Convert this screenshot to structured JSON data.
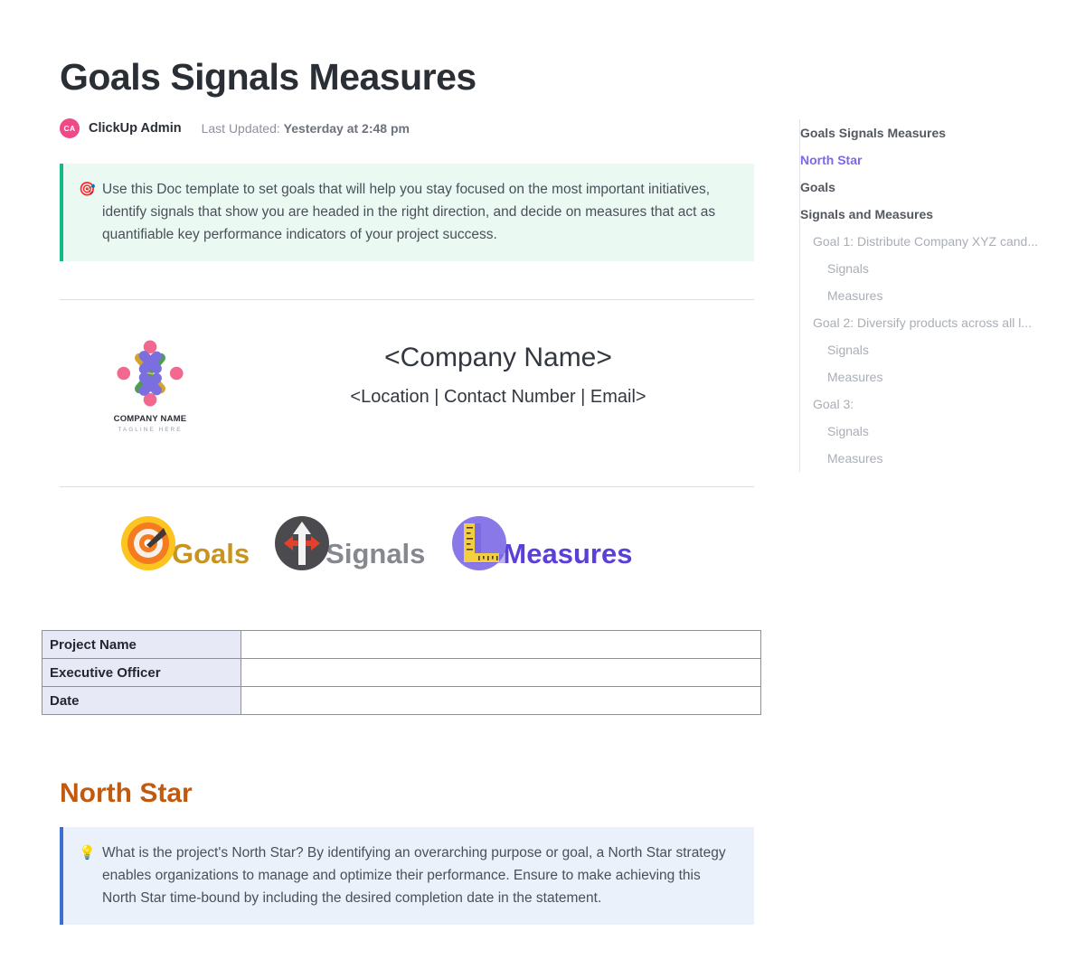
{
  "document": {
    "title": "Goals Signals Measures",
    "byline": {
      "avatar_initials": "CA",
      "author": "ClickUp Admin",
      "updated_prefix": "Last Updated:",
      "updated_value": "Yesterday at 2:48 pm"
    },
    "intro_callout": {
      "icon": "dart-target-emoji",
      "glyph": "🎯",
      "text": "Use this Doc template to set goals that will help you stay focused on the most important initiatives, identify signals that show you are headed in the right direction, and decide on measures that act as quantifiable key performance indicators of your project success.",
      "bar_color": "#14b98a",
      "background": "#eafaf3"
    },
    "company": {
      "logo_name": "COMPANY NAME",
      "logo_tagline": "TAGLINE HERE",
      "name": "<Company Name>",
      "contact": "<Location | Contact Number | Email>"
    },
    "gsm": [
      {
        "label": "Goals",
        "icon": "target-icon",
        "color": "#c8941e"
      },
      {
        "label": "Signals",
        "icon": "signpost-icon",
        "color": "#85898f"
      },
      {
        "label": "Measures",
        "icon": "ruler-icon",
        "color": "#5b3fd9"
      }
    ],
    "info_table": {
      "rows": [
        {
          "label": "Project Name",
          "value": ""
        },
        {
          "label": "Executive Officer",
          "value": ""
        },
        {
          "label": "Date",
          "value": ""
        }
      ]
    },
    "north_star": {
      "heading": "North Star",
      "heading_color": "#c1590f",
      "callout": {
        "icon": "lightbulb-emoji",
        "glyph": "💡",
        "text": "What is the project's North Star? By identifying an overarching purpose or goal, a North Star strategy enables organizations to manage and optimize their performance. Ensure to make achieving this North Star time-bound by including the desired completion date in the statement.",
        "bar_color": "#3b6fd4",
        "background": "#eaf1fb"
      }
    }
  },
  "outline": {
    "items": [
      {
        "label": "Goals Signals Measures",
        "level": 0,
        "active": false
      },
      {
        "label": "North Star",
        "level": 0,
        "active": true
      },
      {
        "label": "Goals",
        "level": 0,
        "active": false
      },
      {
        "label": "Signals and Measures",
        "level": 0,
        "active": false
      },
      {
        "label": "Goal 1: Distribute Company XYZ cand...",
        "level": 1,
        "active": false
      },
      {
        "label": "Signals",
        "level": 2,
        "active": false
      },
      {
        "label": "Measures",
        "level": 2,
        "active": false
      },
      {
        "label": "Goal 2: Diversify products across all l...",
        "level": 1,
        "active": false
      },
      {
        "label": "Signals",
        "level": 2,
        "active": false
      },
      {
        "label": "Measures",
        "level": 2,
        "active": false
      },
      {
        "label": "Goal 3:",
        "level": 1,
        "active": false
      },
      {
        "label": "Signals",
        "level": 2,
        "active": false
      },
      {
        "label": "Measures",
        "level": 2,
        "active": false
      }
    ]
  }
}
